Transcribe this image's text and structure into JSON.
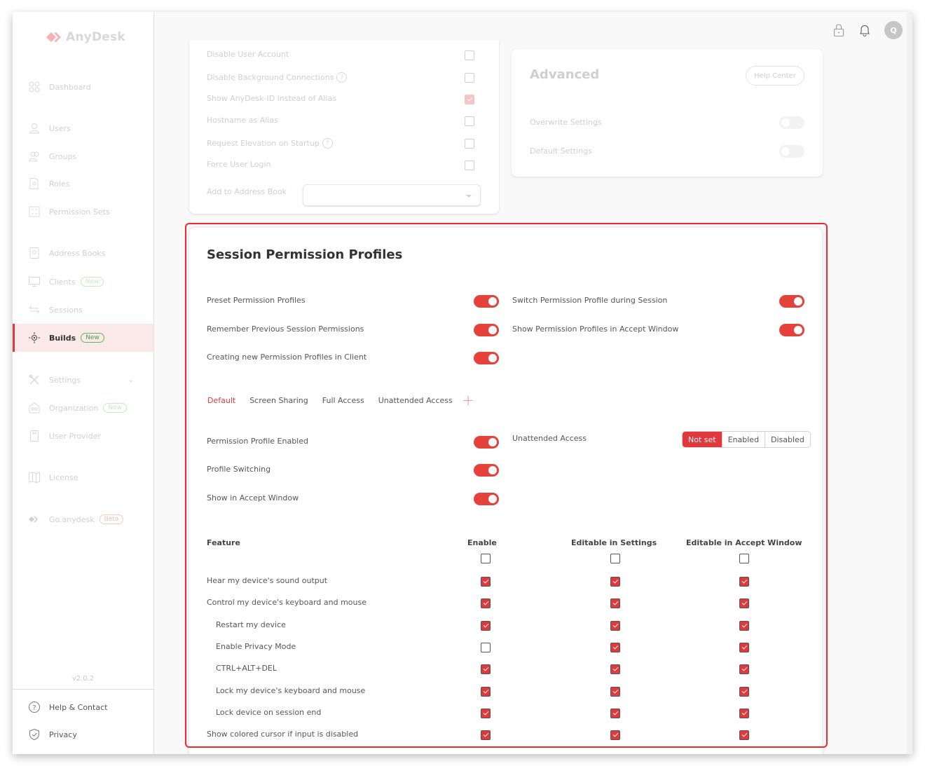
{
  "app": {
    "name": "AnyDesk",
    "version": "v2.0.2"
  },
  "colors": {
    "accent": "#e0383b",
    "badge_new": "#5cb85c",
    "highlight": "#ee2a2f"
  },
  "sidebar": {
    "items": [
      {
        "label": "Dashboard",
        "icon": "dashboard-icon"
      },
      {
        "label": "Users",
        "icon": "user-icon"
      },
      {
        "label": "Groups",
        "icon": "group-icon"
      },
      {
        "label": "Roles",
        "icon": "role-icon"
      },
      {
        "label": "Permission Sets",
        "icon": "checklist-icon"
      },
      {
        "label": "Address Books",
        "icon": "address-book-icon"
      },
      {
        "label": "Clients",
        "icon": "monitor-icon",
        "badge": "New"
      },
      {
        "label": "Sessions",
        "icon": "arrows-icon"
      },
      {
        "label": "Builds",
        "icon": "build-icon",
        "badge": "New",
        "active": true
      },
      {
        "label": "Settings",
        "icon": "tools-icon"
      },
      {
        "label": "Organization",
        "icon": "building-icon",
        "badge": "New"
      },
      {
        "label": "User Provider",
        "icon": "provider-icon"
      },
      {
        "label": "License",
        "icon": "book-icon"
      },
      {
        "label": "Go.anydesk",
        "icon": "anydesk-mark-icon",
        "badge": "Beta"
      }
    ],
    "footer": [
      {
        "label": "Help & Contact",
        "icon": "help-icon"
      },
      {
        "label": "Privacy",
        "icon": "shield-icon"
      }
    ]
  },
  "topbar": {
    "avatar_initial": "Q"
  },
  "general_card": {
    "rows": [
      {
        "label": "Disable User Account",
        "checked": false
      },
      {
        "label": "Disable Background Connections",
        "checked": false,
        "help": true
      },
      {
        "label": "Show AnyDesk-ID instead of Alias",
        "checked": true
      },
      {
        "label": "Hostname as Alias",
        "checked": false
      },
      {
        "label": "Request Elevation on Startup",
        "checked": false,
        "help": true
      },
      {
        "label": "Force User Login",
        "checked": false
      }
    ],
    "address_book_label": "Add to Address Book",
    "address_book_value": ""
  },
  "advanced_card": {
    "title": "Advanced",
    "help_button": "Help Center",
    "rows": [
      {
        "label": "Overwrite Settings",
        "on": false
      },
      {
        "label": "Default Settings",
        "on": false
      }
    ]
  },
  "session_profiles": {
    "title": "Session Permission Profiles",
    "left_toggles": [
      {
        "label": "Preset Permission Profiles",
        "on": true
      },
      {
        "label": "Remember Previous Session Permissions",
        "on": true
      },
      {
        "label": "Creating new Permission Profiles in Client",
        "on": true
      }
    ],
    "right_toggles": [
      {
        "label": "Switch Permission Profile during Session",
        "on": true
      },
      {
        "label": "Show Permission Profiles in Accept Window",
        "on": true
      }
    ],
    "tabs": [
      {
        "label": "Default",
        "active": true
      },
      {
        "label": "Screen Sharing"
      },
      {
        "label": "Full Access"
      },
      {
        "label": "Unattended Access"
      }
    ],
    "add_tab_icon": "plus-icon",
    "profile_toggles": [
      {
        "label": "Permission Profile Enabled",
        "on": true
      },
      {
        "label": "Profile Switching",
        "on": true
      },
      {
        "label": "Show in Accept Window",
        "on": true
      }
    ],
    "unattended": {
      "label": "Unattended Access",
      "options": [
        "Not set",
        "Enabled",
        "Disabled"
      ],
      "selected": "Not set"
    },
    "table": {
      "headers": [
        "Feature",
        "Enable",
        "Editable in Settings",
        "Editable in Accept Window"
      ],
      "header_checks": [
        false,
        false,
        false
      ],
      "rows": [
        {
          "label": "Hear my device's sound output",
          "indent": false,
          "checks": [
            true,
            true,
            true
          ]
        },
        {
          "label": "Control my device's keyboard and mouse",
          "indent": false,
          "checks": [
            true,
            true,
            true
          ]
        },
        {
          "label": "Restart my device",
          "indent": true,
          "checks": [
            true,
            true,
            true
          ]
        },
        {
          "label": "Enable Privacy Mode",
          "indent": true,
          "checks": [
            false,
            true,
            true
          ]
        },
        {
          "label": "CTRL+ALT+DEL",
          "indent": true,
          "checks": [
            true,
            true,
            true
          ]
        },
        {
          "label": "Lock my device's keyboard and mouse",
          "indent": true,
          "checks": [
            true,
            true,
            true
          ]
        },
        {
          "label": "Lock device on session end",
          "indent": true,
          "checks": [
            true,
            true,
            true
          ]
        },
        {
          "label": "Show colored cursor if input is disabled",
          "indent": false,
          "checks": [
            true,
            true,
            true
          ]
        }
      ]
    }
  }
}
